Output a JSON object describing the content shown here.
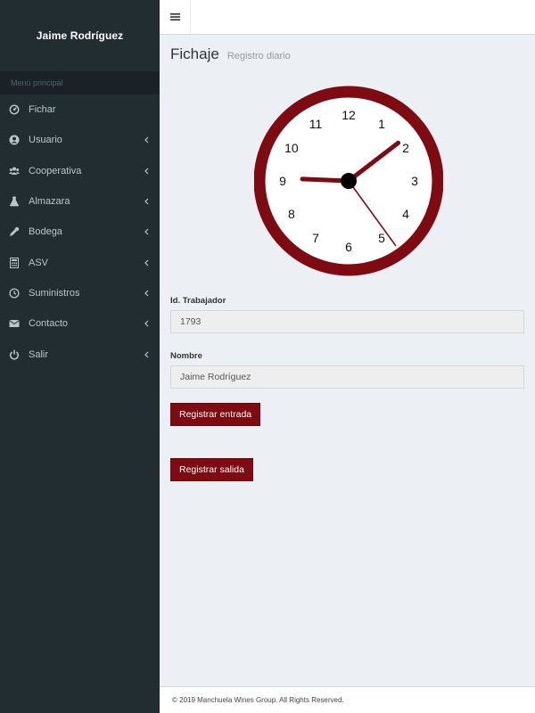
{
  "sidebar": {
    "user_name": "Jaime Rodríguez",
    "header": "Menú principal",
    "items": [
      {
        "label": "Fichar",
        "icon": "dashboard-icon",
        "has_submenu": false
      },
      {
        "label": "Usuario",
        "icon": "user-circle-icon",
        "has_submenu": true
      },
      {
        "label": "Cooperativa",
        "icon": "users-icon",
        "has_submenu": true
      },
      {
        "label": "Almazara",
        "icon": "flask-icon",
        "has_submenu": true
      },
      {
        "label": "Bodega",
        "icon": "eyedropper-icon",
        "has_submenu": true
      },
      {
        "label": "ASV",
        "icon": "calculator-icon",
        "has_submenu": true
      },
      {
        "label": "Suministros",
        "icon": "clock-icon",
        "has_submenu": true
      },
      {
        "label": "Contacto",
        "icon": "envelope-icon",
        "has_submenu": true
      },
      {
        "label": "Salir",
        "icon": "power-icon",
        "has_submenu": true
      }
    ]
  },
  "header": {
    "title": "Fichaje",
    "subtitle": "Registro diario"
  },
  "clock": {
    "numbers": [
      "12",
      "1",
      "2",
      "3",
      "4",
      "5",
      "6",
      "7",
      "8",
      "9",
      "10",
      "11"
    ],
    "time": {
      "hour": 1,
      "minute": 45,
      "second": 24
    },
    "color": "#7d0b11"
  },
  "form": {
    "worker_id_label": "Id. Trabajador",
    "worker_id_value": "1793",
    "name_label": "Nombre",
    "name_value": "Jaime Rodríguez",
    "entry_button": "Registrar entrada",
    "exit_button": "Registrar salida"
  },
  "footer": {
    "text": "© 2019 Manchuela Wines Group. All Rights Reserved."
  },
  "colors": {
    "sidebar_bg": "#222d32",
    "accent": "#7d0b11",
    "content_bg": "#ecf0f5"
  }
}
